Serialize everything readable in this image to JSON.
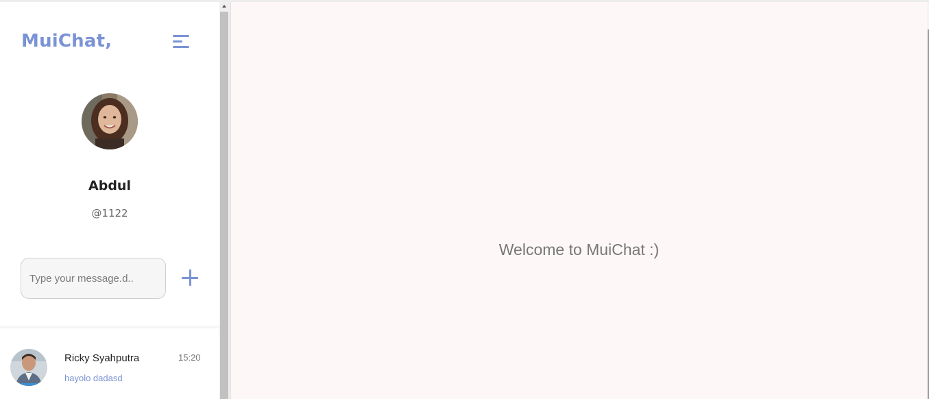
{
  "sidebar": {
    "brand": "MuiChat,",
    "profile": {
      "name": "Abdul",
      "handle": "@1122"
    },
    "compose": {
      "placeholder": "Type your message.d.."
    },
    "chats": [
      {
        "name": "Ricky Syahputra",
        "preview": "hayolo dadasd",
        "time": "15:20"
      }
    ]
  },
  "main": {
    "welcome": "Welcome to MuiChat :)"
  },
  "colors": {
    "accent": "#7b93d5",
    "main_background": "#fdf7f7"
  },
  "icons": {
    "menu": "menu-icon",
    "add": "plus-icon"
  }
}
